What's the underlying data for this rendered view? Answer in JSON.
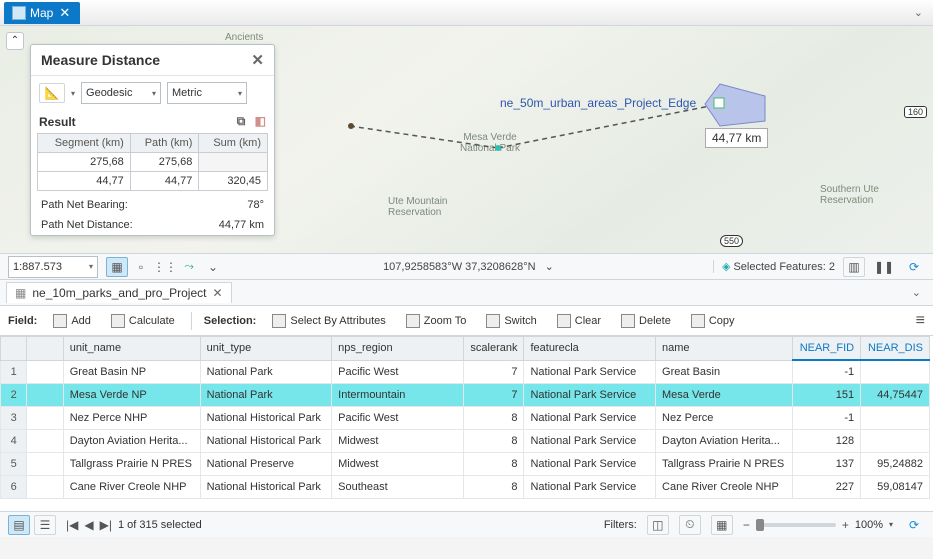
{
  "tab": {
    "title": "Map"
  },
  "measure": {
    "title": "Measure Distance",
    "method": "Geodesic",
    "unit": "Metric",
    "result_label": "Result",
    "headers": [
      "Segment (km)",
      "Path (km)",
      "Sum (km)"
    ],
    "rows": [
      {
        "segment": "275,68",
        "path": "275,68",
        "sum": ""
      },
      {
        "segment": "44,77",
        "path": "44,77",
        "sum": "320,45"
      }
    ],
    "bearing_label": "Path Net Bearing:",
    "bearing_value": "78°",
    "distance_label": "Path Net Distance:",
    "distance_value": "44,77 km"
  },
  "map": {
    "layer_label": "ne_50m_urban_areas_Project_Edge",
    "callout": "44,77 km",
    "mesa_verde": "Mesa Verde\nNational Park",
    "ute": "Ute Mountain\nReservation",
    "sute": "Southern Ute\nReservation",
    "ancients": "Ancients",
    "hwy160": "160",
    "hwy550": "550"
  },
  "status": {
    "scale": "1:887.573",
    "coords": "107,9258583°W 37,3208628°N",
    "selected_label": "Selected Features:",
    "selected_count": "2"
  },
  "table_tab": "ne_10m_parks_and_pro_Project",
  "toolbar": {
    "field": "Field:",
    "add": "Add",
    "calculate": "Calculate",
    "selection": "Selection:",
    "select_by_attr": "Select By Attributes",
    "zoom_to": "Zoom To",
    "switch": "Switch",
    "clear": "Clear",
    "delete": "Delete",
    "copy": "Copy"
  },
  "table": {
    "columns": [
      "",
      "",
      "unit_name",
      "unit_type",
      "nps_region",
      "scalerank",
      "featurecla",
      "name",
      "NEAR_FID",
      "NEAR_DIS"
    ],
    "rows": [
      {
        "n": "1",
        "unit_name": "Great Basin NP",
        "unit_type": "National Park",
        "nps_region": "Pacific West",
        "scalerank": "7",
        "featurecla": "National Park Service",
        "name": "Great Basin",
        "near_fid": "-1",
        "near_dis": ""
      },
      {
        "n": "2",
        "unit_name": "Mesa Verde NP",
        "unit_type": "National Park",
        "nps_region": "Intermountain",
        "scalerank": "7",
        "featurecla": "National Park Service",
        "name": "Mesa Verde",
        "near_fid": "151",
        "near_dis": "44,75447",
        "selected": true
      },
      {
        "n": "3",
        "unit_name": "Nez Perce NHP",
        "unit_type": "National Historical Park",
        "nps_region": "Pacific West",
        "scalerank": "8",
        "featurecla": "National Park Service",
        "name": "Nez Perce",
        "near_fid": "-1",
        "near_dis": ""
      },
      {
        "n": "4",
        "unit_name": "Dayton Aviation Herita...",
        "unit_type": "National Historical Park",
        "nps_region": "Midwest",
        "scalerank": "8",
        "featurecla": "National Park Service",
        "name": "Dayton Aviation Herita...",
        "near_fid": "128",
        "near_dis": ""
      },
      {
        "n": "5",
        "unit_name": "Tallgrass Prairie N PRES",
        "unit_type": "National Preserve",
        "nps_region": "Midwest",
        "scalerank": "8",
        "featurecla": "National Park Service",
        "name": "Tallgrass Prairie N PRES",
        "near_fid": "137",
        "near_dis": "95,24882"
      },
      {
        "n": "6",
        "unit_name": "Cane River Creole NHP",
        "unit_type": "National Historical Park",
        "nps_region": "Southeast",
        "scalerank": "8",
        "featurecla": "National Park Service",
        "name": "Cane River Creole NHP",
        "near_fid": "227",
        "near_dis": "59,08147"
      }
    ]
  },
  "footer": {
    "filters_label": "Filters:",
    "selection_text": "1 of 315 selected",
    "zoom_pct": "100%"
  }
}
